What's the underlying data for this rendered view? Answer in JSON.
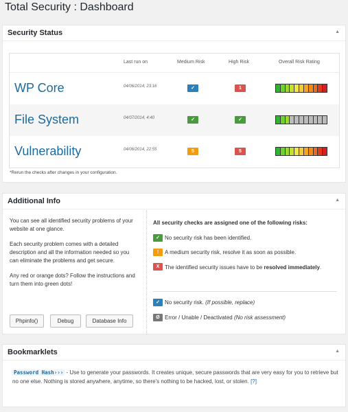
{
  "page": {
    "title": "Total Security : Dashboard"
  },
  "status_box": {
    "title": "Security Status",
    "toggle_icon": "triangle-up",
    "columns": {
      "last_run": "Last run on",
      "medium": "Medium Risk",
      "high": "High Risk",
      "overall": "Overall Risk Rating"
    },
    "rows": [
      {
        "name": "WP Core",
        "date": "04/06/2014, 23:16",
        "medium": "✓",
        "medium_color": "blue",
        "high": "1",
        "high_color": "red",
        "rating_colors": [
          "#2db72d",
          "#6fd12f",
          "#9bd92f",
          "#c6e02f",
          "#f0e64a",
          "#f4c93b",
          "#f5a623",
          "#f28b1a",
          "#ef6a1a",
          "#e43a1c",
          "#d81e1e"
        ]
      },
      {
        "name": "File System",
        "date": "04/07/2014, 4:40",
        "medium": "✓",
        "medium_color": "green",
        "high": "✓",
        "high_color": "green",
        "rating_colors": [
          "#2db72d",
          "#6fd12f",
          "#9bd92f",
          "#bbbbbb",
          "#bbbbbb",
          "#bbbbbb",
          "#bbbbbb",
          "#bbbbbb",
          "#bbbbbb",
          "#bbbbbb",
          "#bbbbbb"
        ]
      },
      {
        "name": "Vulnerability",
        "date": "04/06/2014, 22:55",
        "medium": "5",
        "medium_color": "orange",
        "high": "5",
        "high_color": "red",
        "rating_colors": [
          "#2db72d",
          "#6fd12f",
          "#9bd92f",
          "#c6e02f",
          "#f0e64a",
          "#f4c93b",
          "#f5a623",
          "#f28b1a",
          "#ef6a1a",
          "#e43a1c",
          "#d81e1e"
        ]
      }
    ],
    "footnote": "*Rerun the checks after changes in your configuration."
  },
  "info_box": {
    "title": "Additional Info",
    "paragraphs": [
      "You can see all identified security problems of your website at one glance.",
      "Each security problem comes with a detailed description and all the information needed so you can eliminate the problems and get secure.",
      "Any red or orange dots? Follow the instructions and turn them into green dots!"
    ],
    "buttons": [
      "Phpinfo()",
      "Debug",
      "Database Info"
    ],
    "right_heading": "All security checks are assigned one of the following risks:",
    "legend": [
      {
        "badge": "✓",
        "color": "#4a9b3d",
        "text": "No security risk has been identified."
      },
      {
        "badge": "!",
        "color": "#f39c12",
        "text": "A medium security risk, resolve it as soon as possible."
      },
      {
        "badge": "X",
        "color": "#d9534f",
        "text_a": "The identified security issues have to be ",
        "text_b": "resolved immediately",
        "text_c": "."
      },
      {
        "badge": "✓",
        "color": "#2b80b9",
        "text_a": "No security risk. ",
        "text_b": "(If possible, replace)"
      },
      {
        "badge": "Ø",
        "color": "#777777",
        "text_a": "Error / Unable / Deactivated ",
        "text_b": "(No risk assessment)"
      }
    ]
  },
  "bm_box": {
    "title": "Bookmarklets",
    "link": "Password Hash›››",
    "text": " - Use to generate your passwords. It creates unique, secure passwords that are very easy for you to retrieve but no one else. Nothing is stored anywhere, anytime, so there's nothing to be hacked, lost, or stolen. ",
    "help": "[?]"
  }
}
